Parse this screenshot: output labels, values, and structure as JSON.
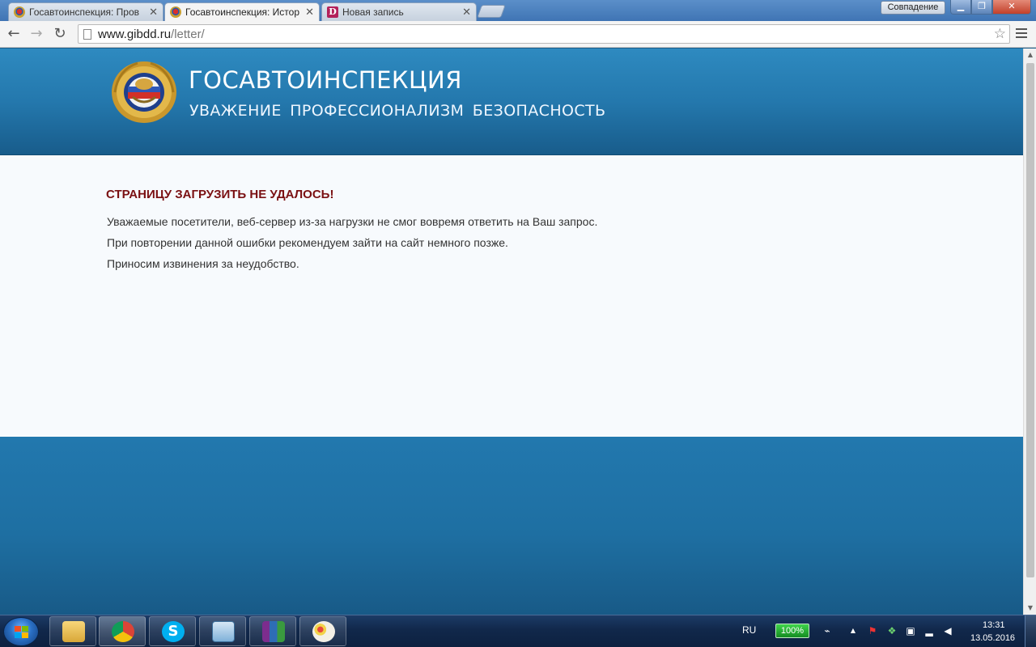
{
  "browser": {
    "tabs": [
      {
        "label": "Госавтоинспекция: Пров"
      },
      {
        "label": "Госавтоинспекция: Истор"
      },
      {
        "label": "Новая запись"
      }
    ],
    "profile_button": "Совпадение",
    "url_domain": "www.gibdd.ru",
    "url_path": "/letter/"
  },
  "site": {
    "title": "ГОСАВТОИНСПЕКЦИЯ",
    "motto": "УВАЖЕНИЕ  ПРОФЕССИОНАЛИЗМ  БЕЗОПАСНОСТЬ"
  },
  "error": {
    "title": "СТРАНИЦУ ЗАГРУЗИТЬ НЕ УДАЛОСЬ!",
    "lines": [
      "Уважаемые посетители, веб-сервер из-за нагрузки не смог вовремя ответить на Ваш запрос.",
      "При повторении данной ошибки рекомендуем зайти на сайт немного позже.",
      "Приносим извинения за неудобство."
    ]
  },
  "taskbar": {
    "apps": [
      "explorer-icon",
      "chrome-icon",
      "skype-icon",
      "remote-desktop-icon",
      "winrar-icon",
      "paint-icon"
    ],
    "language": "RU",
    "battery": "100%",
    "time": "13:31",
    "date": "13.05.2016"
  },
  "colors": {
    "header_blue": "#2478ad",
    "error_red": "#7a1012"
  }
}
